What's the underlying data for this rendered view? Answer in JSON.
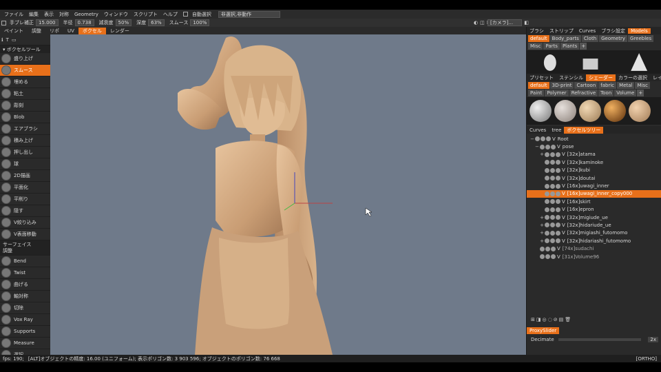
{
  "menu": {
    "items": [
      "ファイル",
      "編集",
      "表示",
      "対称",
      "Geometry",
      "ウィンドウ",
      "スクリプト",
      "ヘルプ"
    ],
    "auto_select_label": "自動選択",
    "selection_mode": "非選択,非動作"
  },
  "toolbar": {
    "stroke_smooth_label": "手ブレ補正",
    "stroke_smooth_value": "15.000",
    "radius_label": "半径",
    "radius_value": "0.738",
    "falloff_label": "減衰度",
    "falloff_value": "50%",
    "depth_label": "深度",
    "depth_value": "63%",
    "smooth_label": "スムース",
    "smooth_value": "100%",
    "camera": "[カメラ]..."
  },
  "tabs": [
    "ペイント",
    "調整",
    "リポ",
    "UV",
    "ボクセル",
    "レンダー"
  ],
  "tabs_active": "ボクセル",
  "left_panel": {
    "category": "ボクセルツール",
    "category2": "サーフェイス\n調整",
    "tools_top": [
      "盛り上げ",
      "スムース",
      "埋める",
      "粘土",
      "彫刻",
      "Blob",
      "エアブラシ",
      "積み上げ",
      "押し出し",
      "球",
      "2D描画",
      "平面化",
      "平削り",
      "隠す",
      "V絞り込み",
      "V表面移動"
    ],
    "tools_active": "スムース",
    "tools_bottom": [
      "Bend",
      "Twist",
      "曲げる",
      "軸対称",
      "切除",
      "Vox Ray",
      "Supports",
      "Measure",
      "選択"
    ]
  },
  "right_panel": {
    "brush_tabs": [
      "ブラシ",
      "ストリップ",
      "Curves",
      "ブラシ設定",
      "Models"
    ],
    "brush_tabs_active": "Models",
    "model_chips": [
      "default",
      "Body_parts",
      "Cloth",
      "Geometry",
      "Greebles",
      "Misc",
      "Parts",
      "Plants"
    ],
    "model_chips_active": "default",
    "preset_tabs": [
      "プリセット",
      "ステンシル",
      "シェーダー",
      "カラーの選択",
      "レイヤー"
    ],
    "preset_tabs_active": "シェーダー",
    "shader_chips": [
      "default",
      "3D-print",
      "Cartoon",
      "fabric",
      "Metal",
      "Misc",
      "Paint",
      "Polymer",
      "Refractive",
      "Toon",
      "Volume"
    ],
    "shader_chips_active": "default",
    "tree_tabs": [
      "Curves",
      "tree",
      "ボクセルツリー"
    ],
    "tree_tabs_active": "ボクセルツリー",
    "tree": [
      {
        "level": 0,
        "ex": "−",
        "label": "Root"
      },
      {
        "level": 1,
        "ex": "−",
        "label": "pose"
      },
      {
        "level": 2,
        "ex": "+",
        "label": "[32x]atama"
      },
      {
        "level": 2,
        "ex": "",
        "label": "[32x]kaminoke"
      },
      {
        "level": 2,
        "ex": "",
        "label": "[32x]kubi"
      },
      {
        "level": 2,
        "ex": "",
        "label": "[32x]doutai"
      },
      {
        "level": 2,
        "ex": "",
        "label": "[16x]uwagi_inner"
      },
      {
        "level": 2,
        "ex": "",
        "label": "[16x]uwagi_inner_copy000",
        "selected": true
      },
      {
        "level": 2,
        "ex": "",
        "label": "[16x]skirt"
      },
      {
        "level": 2,
        "ex": "",
        "label": "[16x]epron"
      },
      {
        "level": 2,
        "ex": "+",
        "label": "[32x]migiude_ue"
      },
      {
        "level": 2,
        "ex": "+",
        "label": "[32x]hidariude_ue"
      },
      {
        "level": 2,
        "ex": "+",
        "label": "[32x]migiashi_futomomo"
      },
      {
        "level": 2,
        "ex": "+",
        "label": "[32x]hidariashi_futomomo"
      },
      {
        "level": 1,
        "ex": "",
        "label": "[74x]sudachi",
        "dim": true
      },
      {
        "level": 1,
        "ex": "",
        "label": "[31x]Volume96",
        "dim": true
      }
    ],
    "proxy_tab": "ProxySlider",
    "decimate_label": "Decimate",
    "decimate_value": "2x"
  },
  "status": {
    "fps": "fps: 190;",
    "text": "[ALT]オブジェクトの精度: 16.00 (ユニフォーム); 表示ポリゴン数: 3 903 596; オブジェクトのポリゴン数: 76 668",
    "mode": "[ORTHO]"
  }
}
